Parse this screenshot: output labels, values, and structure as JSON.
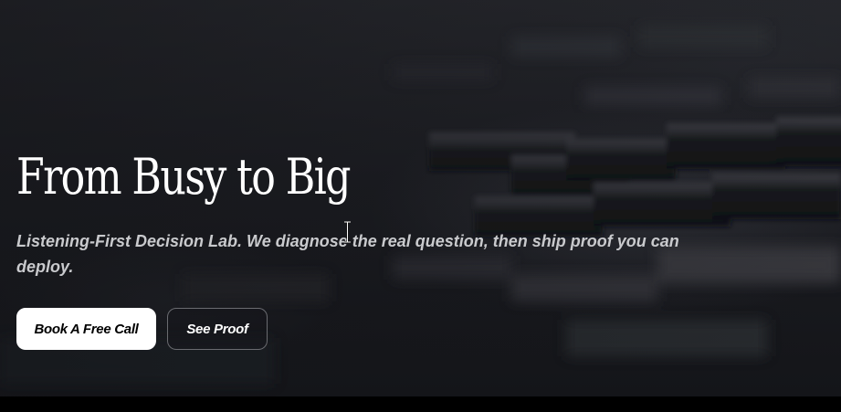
{
  "hero": {
    "headline": "From Busy to Big",
    "subtitle": "Listening-First Decision Lab. We diagnose the real question, then ship proof you can deploy.",
    "primary_button_label": "Book A Free Call",
    "secondary_button_label": "See Proof"
  },
  "colors": {
    "background": "#1b1c21",
    "headline": "#ffffff",
    "subtitle": "#c9cacd",
    "primary_button_bg": "#ffffff",
    "primary_button_text": "#000000",
    "secondary_button_border": "#6a6b70"
  },
  "icons": {
    "pointer": "text-cursor-icon"
  }
}
